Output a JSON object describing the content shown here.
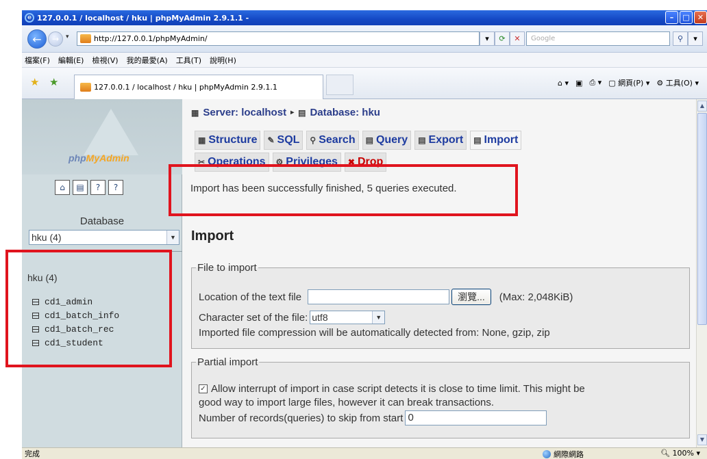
{
  "browser": {
    "title": "127.0.0.1 / localhost / hku | phpMyAdmin 2.9.1.1 -",
    "url": "http://127.0.0.1/phpMyAdmin/",
    "search_placeholder": "Google",
    "menu": [
      "檔案(F)",
      "編輯(E)",
      "檢視(V)",
      "我的最愛(A)",
      "工具(T)",
      "說明(H)"
    ],
    "tab_title": "127.0.0.1 / localhost / hku | phpMyAdmin 2.9.1.1",
    "tools": {
      "page": "網頁(P)",
      "tools": "工具(O)"
    },
    "status_text": "完成",
    "zone": "網際網路",
    "zoom": "100%"
  },
  "sidebar": {
    "logo_php": "php",
    "logo_my": "MyAdmin",
    "db_label": "Database",
    "db_selected": "hku (4)",
    "db_heading": "hku (4)",
    "tables": [
      "cd1_admin",
      "cd1_batch_info",
      "cd1_batch_rec",
      "cd1_student"
    ]
  },
  "main": {
    "server": "Server: localhost",
    "database": "Database: hku",
    "tabs_row1": [
      "Structure",
      "SQL",
      "Search",
      "Query",
      "Export",
      "Import"
    ],
    "tabs_row2": [
      "Operations",
      "Privileges",
      "Drop"
    ],
    "notice": "Import has been successfully finished, 5 queries executed.",
    "section_title": "Import",
    "file_legend": "File to import",
    "location_label": "Location of the text file",
    "browse_label": "瀏覽...",
    "max_label": "(Max: 2,048KiB)",
    "charset_label": "Character set of the file:",
    "charset_value": "utf8",
    "compression_text": "Imported file compression will be automatically detected from: None, gzip, zip",
    "partial_legend": "Partial import",
    "interrupt_text_1": "Allow interrupt of import in case script detects it is close to time limit. This might be",
    "interrupt_text_2": "good way to import large files, however it can break transactions.",
    "skip_label": "Number of records(queries) to skip from start",
    "skip_value": "0"
  }
}
